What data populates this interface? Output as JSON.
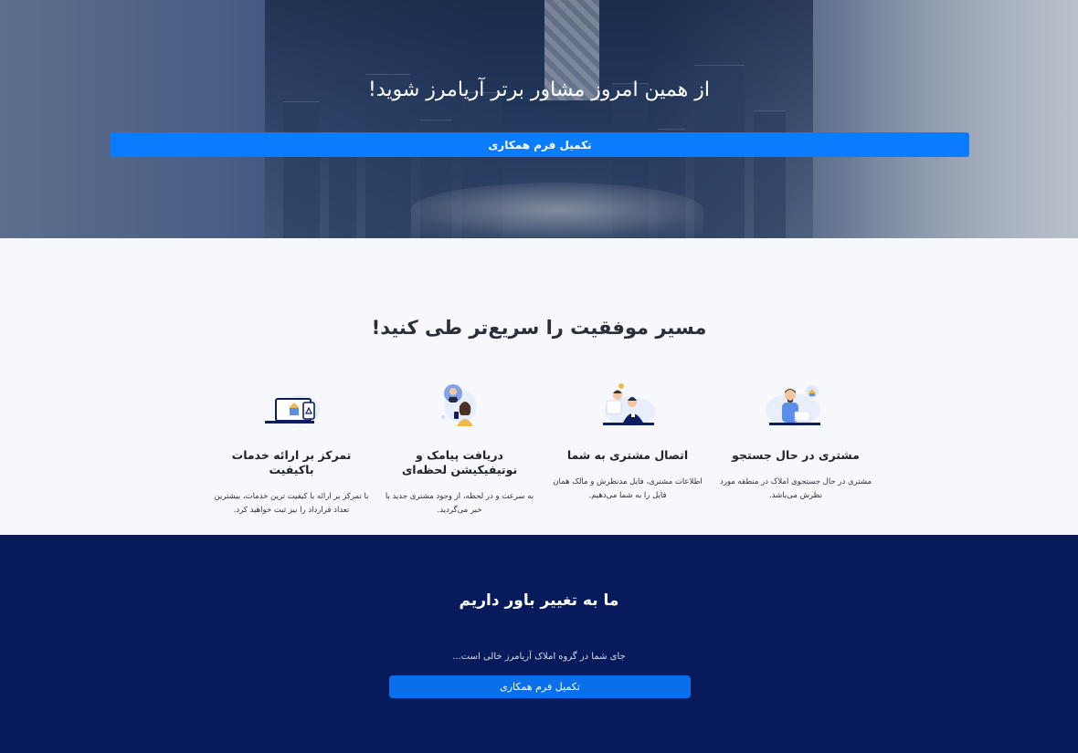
{
  "hero": {
    "title": "از همین امروز مشاور برتر آریامرز شوید!",
    "button_label": "تکمیل فرم همکاری"
  },
  "features": {
    "title": "مسیر موفقیت را سریع‌تر طی کنید!",
    "items": [
      {
        "icon": "customer-searching-icon",
        "title": "مشتری در حال جستجو",
        "text": "مشتری در حال جستجوی املاک در منطقه مورد نظرش می‌باشد."
      },
      {
        "icon": "customer-connection-icon",
        "title": "اتصال مشتری به شما",
        "text": "اطلاعات مشتری، فایل مدنظرش و مالک همان فایل را به شما می‌دهیم."
      },
      {
        "icon": "notification-icon",
        "title": "دریافت پیامک و نوتیفیکیشن لحظه‌ای",
        "text": "به سرعت و در لحظه، از وجود مشتری جدید با خبر می‌گردید."
      },
      {
        "icon": "quality-service-icon",
        "title": "تمرکز بر ارائه خدمات باکیفیت",
        "text": "با تمرکز بر ارائه با کیفیت ترین خدمات، بیشترین تعداد قرارداد را نیز ثبت خواهید کرد."
      }
    ]
  },
  "cta": {
    "title": "ما به تغییر باور داریم",
    "subtitle": "جای شما در گروه املاک آریامرز خالی است...",
    "button_label": "تکمیل فرم همکاری"
  },
  "colors": {
    "primary": "#0a7cff",
    "navy": "#061a5c",
    "background": "#f7f8fb"
  }
}
